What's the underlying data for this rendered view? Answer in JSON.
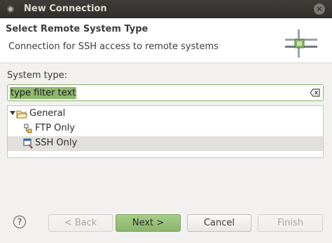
{
  "window": {
    "title": "New Connection",
    "close_glyph": "×"
  },
  "header": {
    "title": "Select Remote System Type",
    "description": "Connection for SSH access to remote systems",
    "graphic_icon": "network-connection-icon"
  },
  "filter": {
    "label": "System type:",
    "value": "type filter text",
    "clear_icon": "clear-text-icon"
  },
  "tree": {
    "group": {
      "label": "General",
      "expanded": true,
      "icon": "folder-open-icon"
    },
    "items": [
      {
        "label": "FTP Only",
        "icon": "ftp-icon",
        "selected": false
      },
      {
        "label": "SSH Only",
        "icon": "ssh-icon",
        "selected": true
      }
    ]
  },
  "buttons": {
    "help": "?",
    "back": "< Back",
    "next": "Next >",
    "cancel": "Cancel",
    "finish": "Finish"
  },
  "colors": {
    "accent_green": "#8ab56a",
    "titlebar": "#3a3935",
    "selection": "#e2e0dc"
  }
}
